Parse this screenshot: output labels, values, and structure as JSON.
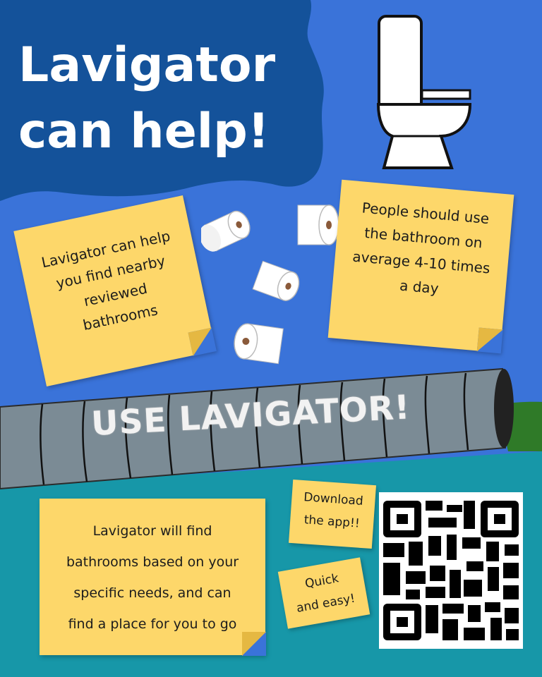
{
  "poster": {
    "title_line1": "Lavigator",
    "title_line2": "can help!",
    "banner": "USE LAVIGATOR!",
    "notes": {
      "find_nearby": [
        "Lavigator can help",
        "you find nearby",
        "reviewed",
        "bathrooms"
      ],
      "frequency": [
        "People should use",
        "the bathroom on",
        "average 4-10 times",
        "a day"
      ],
      "needs": [
        "Lavigator will find",
        "bathrooms based on your",
        "specific needs, and can",
        "find a place for you to go"
      ],
      "download": [
        "Download",
        "the app!!"
      ],
      "quick": [
        "Quick",
        "and easy!"
      ]
    }
  },
  "icons": {
    "toilet": "toilet-icon",
    "paper": "toilet-paper-icon",
    "qr": "qr-code-icon",
    "pipe": "pipe-icon"
  },
  "colors": {
    "sky": "#3a73d9",
    "title_blob": "#14529a",
    "ground": "#1797a8",
    "pipe": "#7b8b95",
    "sticky_note": "#fdd76a",
    "grass": "#2f7a28"
  }
}
